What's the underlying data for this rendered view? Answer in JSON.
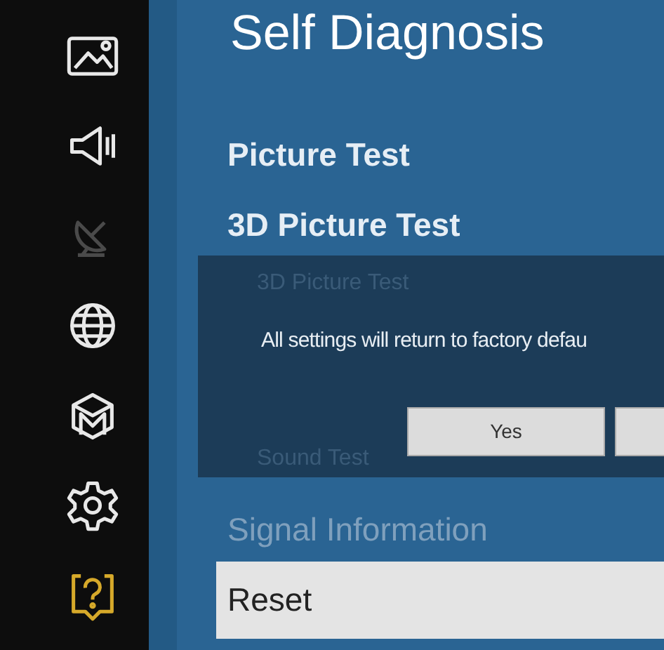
{
  "sidebar": {
    "items": [
      {
        "kind": "picture",
        "selected": false,
        "disabled": false
      },
      {
        "kind": "sound",
        "selected": false,
        "disabled": false
      },
      {
        "kind": "broadcast",
        "selected": false,
        "disabled": true
      },
      {
        "kind": "network",
        "selected": false,
        "disabled": false
      },
      {
        "kind": "apps",
        "selected": false,
        "disabled": false
      },
      {
        "kind": "settings",
        "selected": false,
        "disabled": false
      },
      {
        "kind": "support",
        "selected": true,
        "disabled": false
      }
    ]
  },
  "title": "Self Diagnosis",
  "menu": [
    {
      "label": "Picture Test",
      "selected": false,
      "disabled": false
    },
    {
      "label": "3D Picture Test",
      "selected": false,
      "disabled": false
    },
    {
      "label": "Signal Information",
      "selected": false,
      "disabled": true
    },
    {
      "label": "Reset",
      "selected": true,
      "disabled": false
    }
  ],
  "dialog": {
    "behind_top": "3D Picture Test",
    "message": "All settings will return to factory defau",
    "behind_bottom": "Sound Test",
    "buttons": [
      {
        "label": "Yes",
        "selected": false
      },
      {
        "selected": false
      }
    ]
  }
}
